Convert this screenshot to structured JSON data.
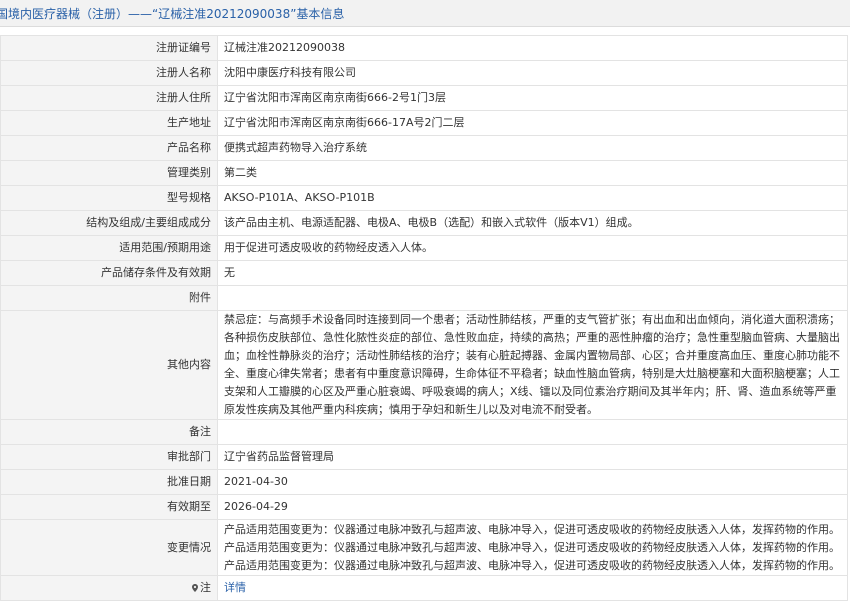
{
  "header": {
    "title": "国境内医疗器械（注册）——“辽械注准20212090038”基本信息"
  },
  "rows": [
    {
      "label": "注册证编号",
      "value": "辽械注准20212090038"
    },
    {
      "label": "注册人名称",
      "value": "沈阳中康医疗科技有限公司"
    },
    {
      "label": "注册人住所",
      "value": "辽宁省沈阳市浑南区南京南街666-2号1门3层"
    },
    {
      "label": "生产地址",
      "value": "辽宁省沈阳市浑南区南京南街666-17A号2门二层"
    },
    {
      "label": "产品名称",
      "value": "便携式超声药物导入治疗系统"
    },
    {
      "label": "管理类别",
      "value": "第二类"
    },
    {
      "label": "型号规格",
      "value": "AKSO-P101A、AKSO-P101B"
    },
    {
      "label": "结构及组成/主要组成成分",
      "value": "该产品由主机、电源适配器、电极A、电极B（选配）和嵌入式软件（版本V1）组成。"
    },
    {
      "label": "适用范围/预期用途",
      "value": "用于促进可透皮吸收的药物经皮透入人体。"
    },
    {
      "label": "产品储存条件及有效期",
      "value": "无"
    },
    {
      "label": "附件",
      "value": ""
    },
    {
      "label": "其他内容",
      "value": "禁忌症：与高频手术设备同时连接到同一个患者；活动性肺结核，严重的支气管扩张；有出血和出血倾向，消化道大面积溃疡；各种损伤皮肤部位、急性化脓性炎症的部位、急性败血症，持续的高热；严重的恶性肿瘤的治疗；急性重型脑血管病、大量脑出血；血栓性静脉炎的治疗；活动性肺结核的治疗；装有心脏起搏器、金属内置物局部、心区；合并重度高血压、重度心肺功能不全、重度心律失常者；患者有中重度意识障碍，生命体征不平稳者；缺血性脑血管病，特别是大灶脑梗塞和大面积脑梗塞；人工支架和人工瓣膜的心区及严重心脏衰竭、呼吸衰竭的病人；X线、镭以及同位素治疗期间及其半年内；肝、肾、造血系统等严重原发性疾病及其他严重内科疾病；慎用于孕妇和新生儿以及对电流不耐受者。"
    },
    {
      "label": "备注",
      "value": ""
    },
    {
      "label": "审批部门",
      "value": "辽宁省药品监督管理局"
    },
    {
      "label": "批准日期",
      "value": "2021-04-30"
    },
    {
      "label": "有效期至",
      "value": "2026-04-29"
    },
    {
      "label": "变更情况",
      "value": "产品适用范围变更为：仪器通过电脉冲致孔与超声波、电脉冲导入，促进可透皮吸收的药物经皮肤透入人体，发挥药物的作用。 产品适用范围变更为：仪器通过电脉冲致孔与超声波、电脉冲导入，促进可透皮吸收的药物经皮肤透入人体，发挥药物的作用。 产品适用范围变更为：仪器通过电脉冲致孔与超声波、电脉冲导入，促进可透皮吸收的药物经皮肤透入人体，发挥药物的作用。"
    }
  ],
  "footer_row": {
    "label": "注",
    "link": "详情"
  },
  "icons": {
    "location": "location-pin-icon"
  }
}
